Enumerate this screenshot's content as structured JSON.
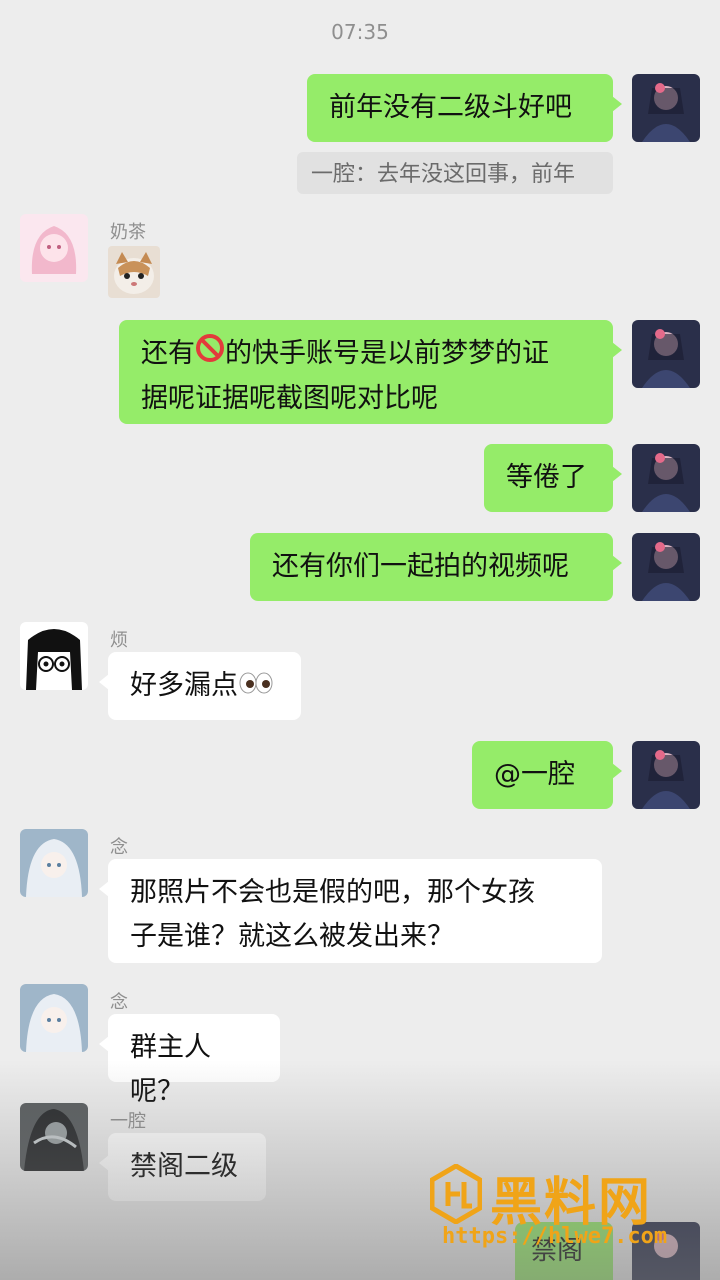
{
  "timestamp": "07:35",
  "messages": {
    "m1": {
      "text": "前年没有二级斗好吧"
    },
    "m1_quote": {
      "text": "一腔：去年没这回事，前年"
    },
    "m2": {
      "sender": "奶茶"
    },
    "m3": {
      "line1_a": "还有",
      "line1_b": "的快手账号是以前梦梦的证",
      "line2": "据呢证据呢截图呢对比呢"
    },
    "m4": {
      "text": "等倦了"
    },
    "m5": {
      "text": "还有你们一起拍的视频呢"
    },
    "m6": {
      "sender": "烦",
      "text": "好多漏点"
    },
    "m7": {
      "text": "@一腔"
    },
    "m8": {
      "sender": "念",
      "line1": "那照片不会也是假的吧，那个女孩",
      "line2": "子是谁？就这么被发出来？"
    },
    "m9": {
      "sender": "念",
      "text": "群主人呢？"
    },
    "m10": {
      "sender": "一腔",
      "text": "禁阁二级"
    },
    "m11": {
      "text": "禁阁"
    }
  },
  "watermark": {
    "title": "黑料网",
    "url": "https://hlwe7.com"
  }
}
